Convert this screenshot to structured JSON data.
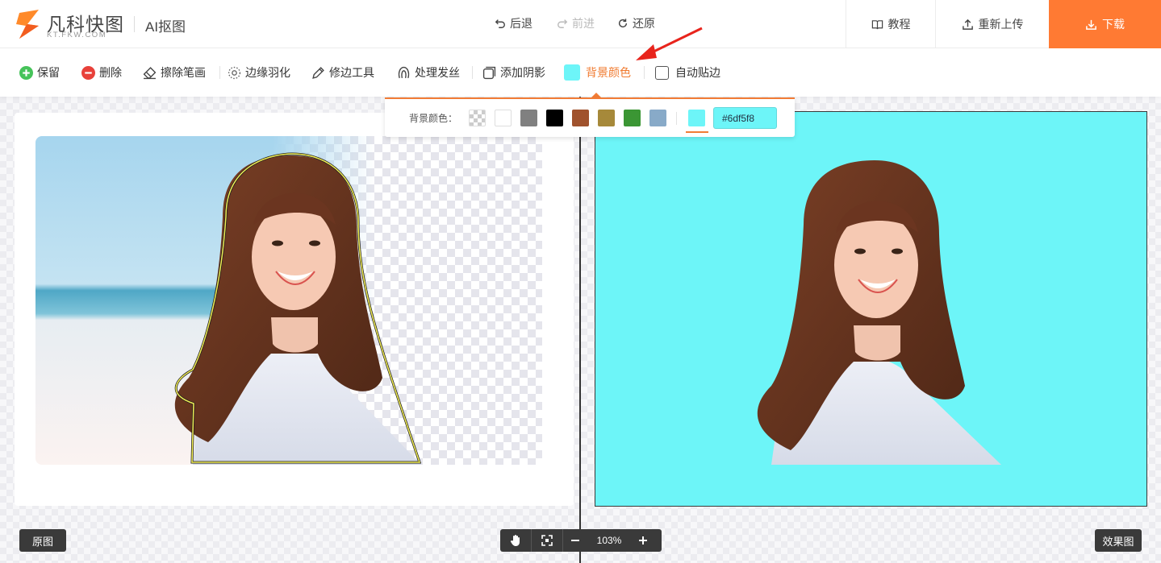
{
  "brand": {
    "name": "凡科快图",
    "sub": "KT.FKW.COM",
    "app_title": "AI抠图"
  },
  "history": {
    "undo": "后退",
    "redo": "前进",
    "restore": "还原"
  },
  "header_actions": {
    "tutorial": "教程",
    "reupload": "重新上传",
    "download": "下载"
  },
  "toolbar": {
    "keep": "保留",
    "delete": "删除",
    "eraser": "擦除笔画",
    "feather": "边缘羽化",
    "edge_tool": "修边工具",
    "hair": "处理发丝",
    "shadow": "添加阴影",
    "bg_color": "背景颜色",
    "auto_snap": "自动贴边"
  },
  "bg_popup": {
    "label": "背景颜色：",
    "swatches": [
      "transparent",
      "#ffffff",
      "#808080",
      "#000000",
      "#a0522d",
      "#a6893a",
      "#3b9634",
      "#88aac8"
    ],
    "current_color": "#6df5f8",
    "hex_value": "#6df5f8"
  },
  "view_labels": {
    "original": "原图",
    "result": "效果图"
  },
  "zoom": {
    "level": "103%"
  },
  "colors": {
    "accent": "#ff7a33",
    "bg_color": "#6df5f8",
    "popup_border": "#f27c36"
  },
  "icons": {
    "logo": "fkw-logo-icon",
    "undo": "undo-icon",
    "redo": "redo-icon",
    "restore": "restore-icon",
    "tutorial": "book-icon",
    "upload": "upload-icon",
    "download": "download-icon",
    "keep": "plus-circle-icon",
    "delete": "minus-circle-icon",
    "eraser": "eraser-icon",
    "feather": "feather-dots-icon",
    "edge": "pen-icon",
    "hair": "hair-icon",
    "shadow": "shadow-icon",
    "hand": "hand-icon",
    "fit": "fit-screen-icon",
    "zoom_out": "minus-icon",
    "zoom_in": "plus-icon"
  }
}
